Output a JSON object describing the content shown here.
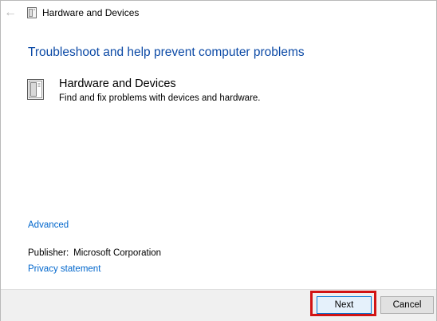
{
  "window": {
    "title": "Hardware and Devices",
    "back_icon": "back-arrow-icon",
    "title_icon": "hardware-devices-icon"
  },
  "main": {
    "heading": "Troubleshoot and help prevent computer problems",
    "troubleshooter": {
      "icon": "hardware-devices-icon",
      "title": "Hardware and Devices",
      "description": "Find and fix problems with devices and hardware."
    },
    "advanced_link": "Advanced",
    "publisher_label": "Publisher:",
    "publisher_value": "Microsoft Corporation",
    "privacy_link": "Privacy statement"
  },
  "footer": {
    "next_label": "Next",
    "cancel_label": "Cancel"
  },
  "colors": {
    "heading": "#0c4aa6",
    "link": "#0066cc",
    "highlight": "#d21414",
    "footer_bg": "#f0f0f0"
  }
}
